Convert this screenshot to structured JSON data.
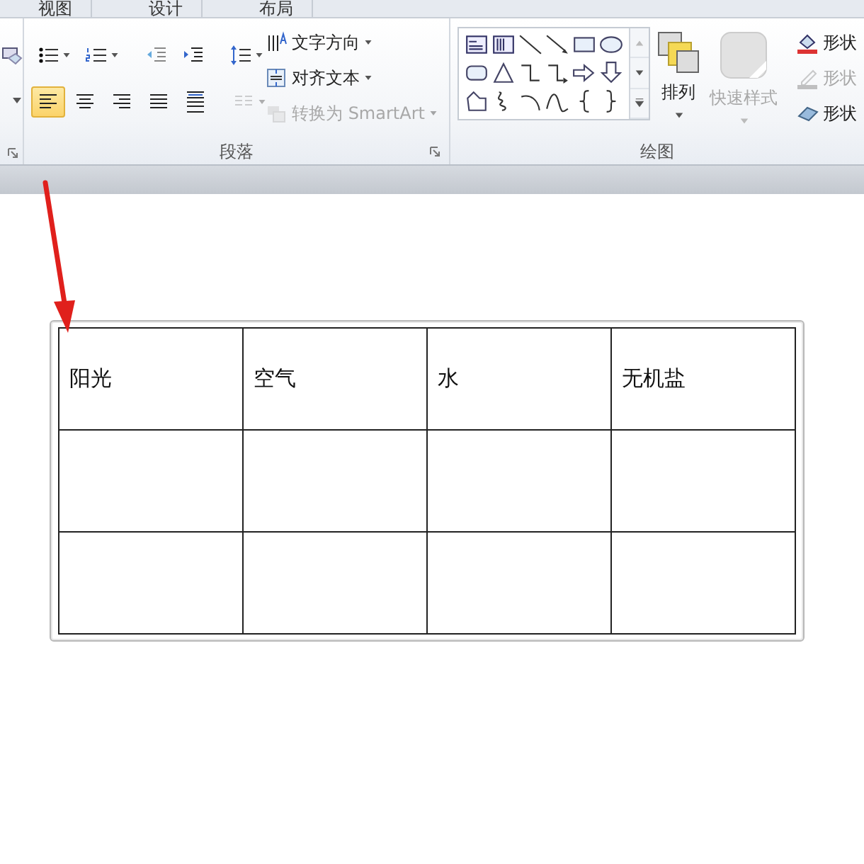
{
  "tabs": [
    {
      "label": "视图",
      "selected": false
    },
    {
      "label": "设计",
      "selected": false
    },
    {
      "label": "布局",
      "selected": false
    }
  ],
  "paragraph_group": {
    "title": "段落",
    "row1": [
      {
        "kind": "bullets",
        "dropdown": true
      },
      {
        "kind": "numbering",
        "dropdown": true
      },
      {
        "kind": "outdent",
        "dropdown": false
      },
      {
        "kind": "indent",
        "dropdown": false
      },
      {
        "kind": "line-spacing",
        "dropdown": true
      }
    ],
    "alignment": [
      {
        "kind": "left",
        "selected": true
      },
      {
        "kind": "center",
        "selected": false
      },
      {
        "kind": "right",
        "selected": false
      },
      {
        "kind": "justify",
        "selected": false
      },
      {
        "kind": "distributed",
        "selected": false
      }
    ],
    "columns_button": {
      "disabled": true
    },
    "commands": [
      {
        "kind": "text-direction",
        "label": "文字方向",
        "disabled": false
      },
      {
        "kind": "align-text",
        "label": "对齐文本",
        "disabled": false
      },
      {
        "kind": "smartart",
        "label": "转换为 SmartArt",
        "disabled": true
      }
    ]
  },
  "drawing_group": {
    "title": "绘图",
    "shapes": [
      {
        "kind": "textbox"
      },
      {
        "kind": "vtextbox"
      },
      {
        "kind": "line"
      },
      {
        "kind": "arrow"
      },
      {
        "kind": "rect"
      },
      {
        "kind": "oval"
      },
      {
        "kind": "roundrect"
      },
      {
        "kind": "triangle"
      },
      {
        "kind": "elbow"
      },
      {
        "kind": "elbowarrow"
      },
      {
        "kind": "rightarrow"
      },
      {
        "kind": "downarrow"
      },
      {
        "kind": "freeform"
      },
      {
        "kind": "scribble"
      },
      {
        "kind": "arc"
      },
      {
        "kind": "curve"
      },
      {
        "kind": "lbrace"
      },
      {
        "kind": "rbrace"
      }
    ],
    "arrange": {
      "label": "排列",
      "disabled": false
    },
    "quick_styles": {
      "label": "快速样式",
      "disabled": true
    },
    "shape_commands": [
      {
        "kind": "fill",
        "label": "形状",
        "disabled": false
      },
      {
        "kind": "outline",
        "label": "形状",
        "disabled": true
      },
      {
        "kind": "effects",
        "label": "形状",
        "disabled": false
      }
    ]
  },
  "table": {
    "rows": [
      {
        "cells": [
          {
            "text": "阳光"
          },
          {
            "text": "空气"
          },
          {
            "text": "水"
          },
          {
            "text": "无机盐"
          }
        ]
      },
      {
        "cells": [
          {},
          {},
          {},
          {}
        ]
      },
      {
        "cells": [
          {},
          {},
          {},
          {}
        ]
      }
    ]
  }
}
